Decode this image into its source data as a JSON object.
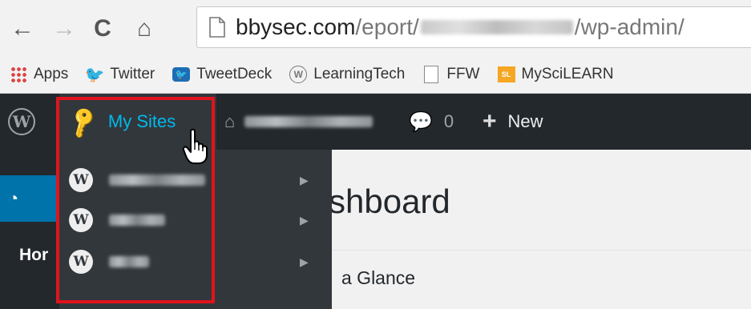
{
  "browser": {
    "nav_back_glyph": "←",
    "nav_forward_glyph": "→",
    "nav_reload_glyph": "C",
    "nav_home_glyph": "⌂",
    "url_host": "bbysec.com",
    "url_path_before": "/eport/",
    "url_path_after": "/wp-admin/"
  },
  "bookmarks": [
    {
      "label": "Apps",
      "icon": "apps-grid-icon"
    },
    {
      "label": "Twitter",
      "icon": "twitter-bird-icon"
    },
    {
      "label": "TweetDeck",
      "icon": "tweetdeck-icon"
    },
    {
      "label": "LearningTech",
      "icon": "wordpress-icon"
    },
    {
      "label": "FFW",
      "icon": "page-icon"
    },
    {
      "label": "MySciLEARN",
      "icon": "myscilearn-icon"
    }
  ],
  "adminbar": {
    "my_sites_label": "My Sites",
    "comments_count": "0",
    "new_label": "New"
  },
  "sidebar": {
    "home_label": "Hor"
  },
  "main": {
    "page_title": "shboard",
    "widget_title": "a Glance"
  },
  "dropdown_arrow": "▶",
  "colors": {
    "adminbar_bg": "#23282d",
    "submenu_bg": "#32373c",
    "accent_blue": "#00b9eb",
    "active_menu_blue": "#0073aa",
    "highlight_red": "#e0141c"
  }
}
